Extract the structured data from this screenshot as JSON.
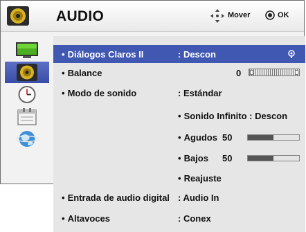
{
  "header": {
    "title": "AUDIO",
    "hint_move": "Mover",
    "hint_ok": "OK"
  },
  "sidebar": {
    "items": [
      {
        "icon": "tv-picture-icon"
      },
      {
        "icon": "speaker-audio-icon",
        "selected": true
      },
      {
        "icon": "clock-icon"
      },
      {
        "icon": "calendar-lock-icon"
      },
      {
        "icon": "globe-network-icon"
      }
    ]
  },
  "rows": {
    "dialogos": {
      "label": "Diálogos Claros II",
      "value": ": Descon"
    },
    "balance": {
      "label": "Balance",
      "value": "0"
    },
    "modo": {
      "label": "Modo de sonido",
      "value": ": Estándar"
    },
    "infinito": {
      "label": "Sonido Infinito : Descon"
    },
    "agudos": {
      "label": "Agudos",
      "value": "50",
      "level_percent": 50
    },
    "bajos": {
      "label": "Bajos",
      "value": "50",
      "level_percent": 50
    },
    "reajuste": {
      "label": "Reajuste"
    },
    "entrada": {
      "label": "Entrada de audio digital",
      "value": ": Audio In"
    },
    "altavoces": {
      "label": "Altavoces",
      "value": ": Conex"
    }
  },
  "colors": {
    "highlight": "#4158b3",
    "sidebar_selected": "#4a5fb8",
    "panel_bg": "#e6e6e6"
  }
}
